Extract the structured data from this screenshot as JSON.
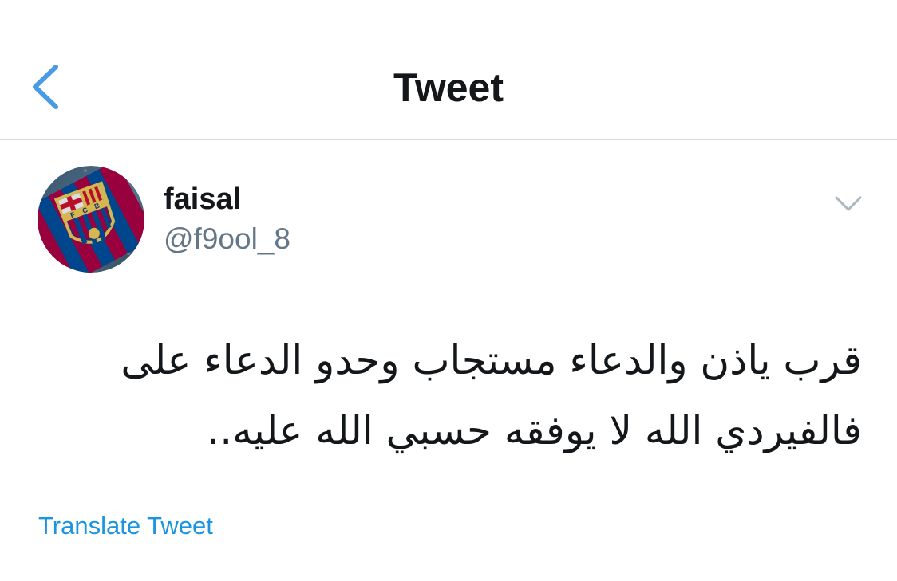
{
  "navbar": {
    "title": "Tweet",
    "back_icon": "chevron-left-icon"
  },
  "tweet": {
    "author": {
      "display_name": "faisal",
      "handle": "@f9ool_8",
      "avatar": "fc-barcelona-flag-avatar"
    },
    "menu_icon": "chevron-down-icon",
    "text": "قرب ياذن والدعاء مستجاب وحدو الدعاء على فالفيردي الله لا يوفقه حسبي الله عليه..",
    "translate_label": "Translate Tweet"
  },
  "colors": {
    "accent": "#1b95e0",
    "back_chevron": "#4a9be5",
    "primary_text": "#14171a",
    "secondary_text": "#657786",
    "divider": "#d9dde1",
    "menu_chevron": "#aab8c2"
  }
}
